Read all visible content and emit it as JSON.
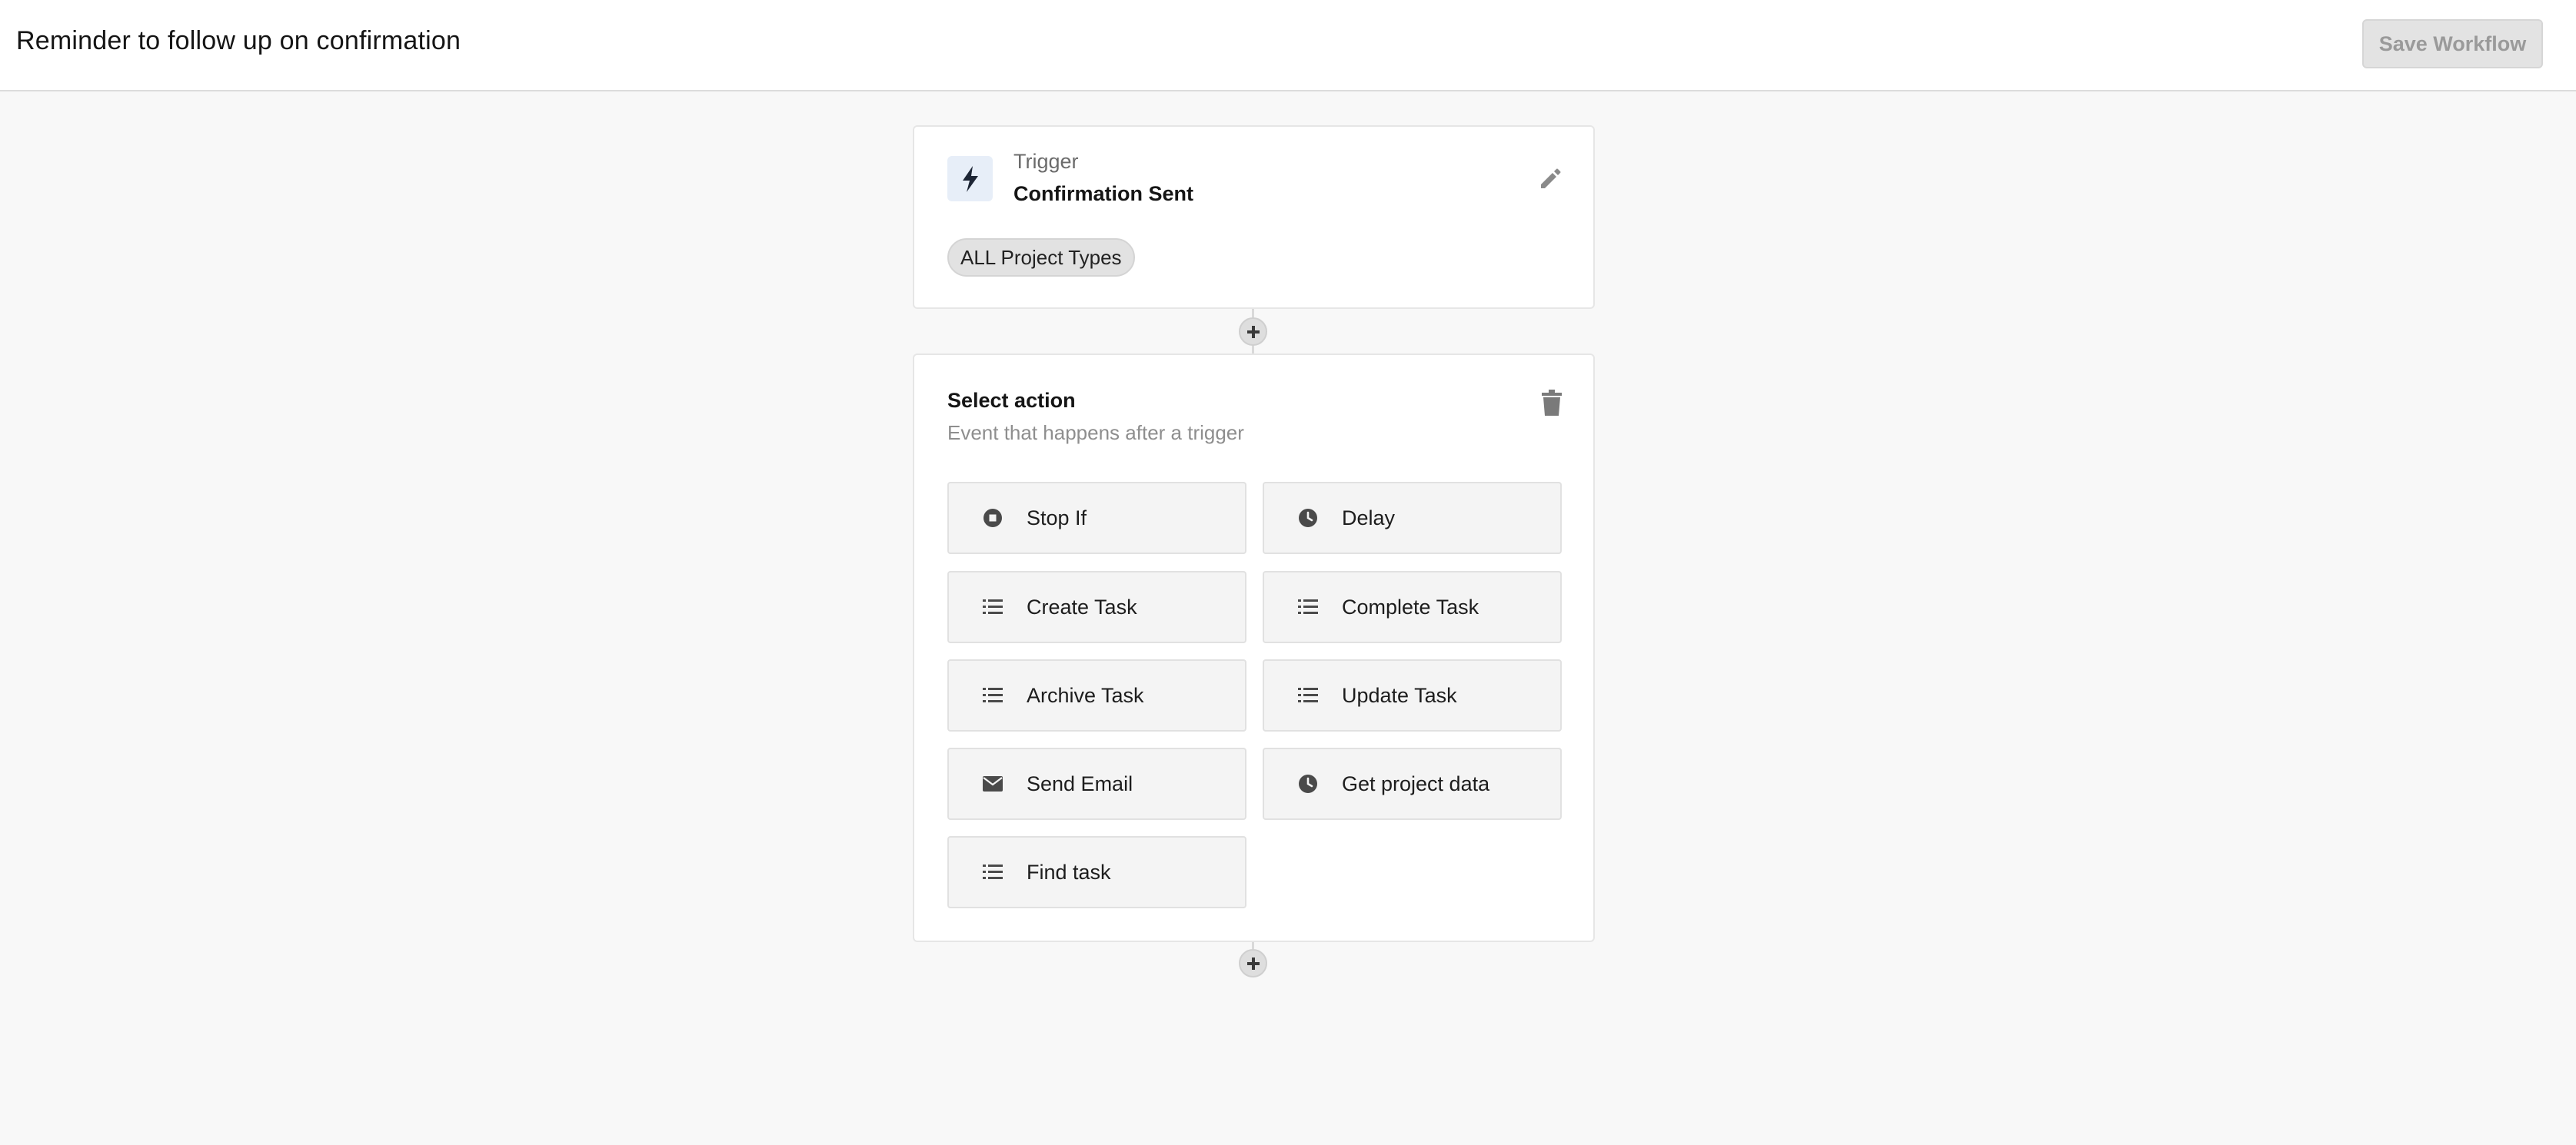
{
  "header": {
    "title": "Reminder to follow up on confirmation",
    "save_label": "Save Workflow"
  },
  "trigger": {
    "label": "Trigger",
    "name": "Confirmation Sent",
    "filter_pill": "ALL Project Types",
    "icon": "lightning-bolt-icon",
    "edit_icon": "pencil-icon"
  },
  "action": {
    "title": "Select action",
    "subtitle": "Event that happens after a trigger",
    "delete_icon": "trash-icon",
    "options": [
      {
        "label": "Stop If",
        "icon": "stop-circle-icon"
      },
      {
        "label": "Delay",
        "icon": "clock-icon"
      },
      {
        "label": "Create Task",
        "icon": "list-icon"
      },
      {
        "label": "Complete Task",
        "icon": "list-icon"
      },
      {
        "label": "Archive Task",
        "icon": "list-icon"
      },
      {
        "label": "Update Task",
        "icon": "list-icon"
      },
      {
        "label": "Send Email",
        "icon": "envelope-icon"
      },
      {
        "label": "Get project data",
        "icon": "clock-icon"
      },
      {
        "label": "Find task",
        "icon": "list-icon"
      }
    ]
  },
  "colors": {
    "background": "#f8f8f8",
    "card": "#ffffff",
    "trigger_icon_bg": "#e7eef8",
    "icon_dark": "#1d2535",
    "disabled_button": "#e3e3e3",
    "disabled_text": "#9a9a9a"
  }
}
